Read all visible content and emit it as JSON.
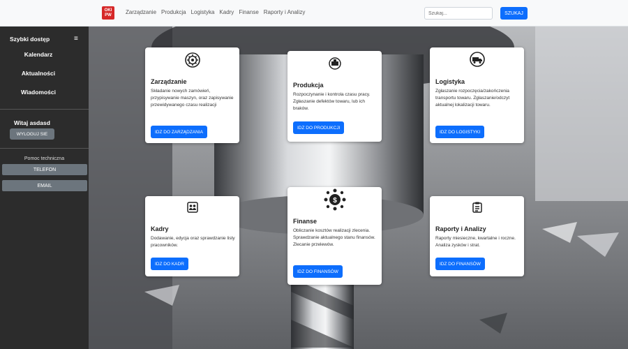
{
  "navbar": {
    "logo_text": [
      "OKI",
      "PW"
    ],
    "links": [
      "Zarządzanie",
      "Produkcja",
      "Logistyka",
      "Kadry",
      "Finanse",
      "Raporty i Analizy"
    ],
    "search_placeholder": "Szukaj...",
    "search_button": "SZUKAJ"
  },
  "sidebar": {
    "title": "Szybki dostęp",
    "menu_icon": "≡",
    "links": [
      "Kalendarz",
      "Aktualności",
      "Wiadomości"
    ],
    "welcome": "Witaj asdasd",
    "logout": "WYLOGUJ SIE",
    "help_title": "Pomoc techniczna",
    "help_buttons": [
      "TELEFON",
      "EMAIL"
    ]
  },
  "cards": [
    {
      "icon": "gear-icon",
      "title": "Zarządzanie",
      "text": "Składanie nowych zamówień, przypisywanie maszyn, oraz zapisywanie przewidywanego czasu realizacji",
      "button": "IDZ DO ZARZĄDZANIA"
    },
    {
      "icon": "machine-icon",
      "title": "Produkcja",
      "text": "Rozpoczynanie i kontrola czasu pracy. Zgłaszanie defektów towaru, lub ich braków.",
      "button": "IDZ DO PRODUKCJI"
    },
    {
      "icon": "truck-icon",
      "title": "Logistyka",
      "text": "Zgłaszanie rozpoczęcia/zakończenia transportu towaru. Zgłaszanie/odczyt aktualnej lokalizacji towaru.",
      "button": "IDZ DO LOGISTYKI"
    },
    {
      "icon": "people-icon",
      "title": "Kadry",
      "text": "Dodawanie, edycja oraz sprawdzanie listy pracowników.",
      "button": "IDZ DO KADR"
    },
    {
      "icon": "money-icon",
      "title": "Finanse",
      "text": "Obliczanie kosztów realizacji zlecenia. Sprawdzanie aktualnego stanu finansów. Zlecanie przelewów.",
      "button": "IDZ DO FINANSÓW"
    },
    {
      "icon": "clipboard-icon",
      "title": "Raporty i Analizy",
      "text": "Raporty miesieczne, kwartalne i roczne. Analiza zysków i strat.",
      "button": "IDZ DO FINANSÓW"
    }
  ],
  "colors": {
    "primary": "#0d6efd",
    "sidebar": "#2c2c2c",
    "secondary_button": "#6c757d",
    "logo": "#d62828"
  }
}
